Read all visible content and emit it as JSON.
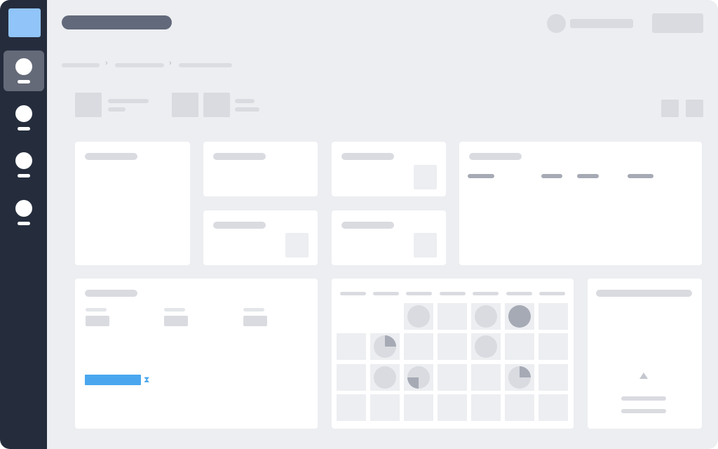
{
  "theme": {
    "sidebar_bg": "#252d3d",
    "logo_color": "#91c4f8",
    "content_bg": "#eceef1",
    "card_bg": "#ffffff",
    "accent": "#4aa7ef",
    "placeholder": "#d9dbe0"
  },
  "sidebar": {
    "logo": "app-logo",
    "items": [
      {
        "name": "nav-item-1",
        "active": true
      },
      {
        "name": "nav-item-2",
        "active": false
      },
      {
        "name": "nav-item-3",
        "active": false
      },
      {
        "name": "nav-item-4",
        "active": false
      }
    ]
  },
  "header": {
    "title": "",
    "user_name": "",
    "action_button": ""
  },
  "breadcrumb": [
    "",
    "",
    ""
  ],
  "toolbar": {
    "icons": [
      "view-grid-icon",
      "view-list-icon"
    ]
  },
  "progress_widget": {
    "progress": 0.62,
    "icon": "hourglass-icon",
    "hourglass_glyph": "⧗"
  },
  "calendar": {
    "columns": 7,
    "rows": 4,
    "marked_cells": [
      {
        "row": 0,
        "col": 2,
        "fill": 0.0
      },
      {
        "row": 0,
        "col": 4,
        "fill": 0.0
      },
      {
        "row": 0,
        "col": 5,
        "fill": 1.0
      },
      {
        "row": 1,
        "col": 1,
        "fill": 0.25
      },
      {
        "row": 1,
        "col": 4,
        "fill": 0.0
      },
      {
        "row": 2,
        "col": 1,
        "fill": 0.0
      },
      {
        "row": 2,
        "col": 2,
        "fill": 0.25
      },
      {
        "row": 2,
        "col": 5,
        "fill": 0.25
      }
    ]
  }
}
